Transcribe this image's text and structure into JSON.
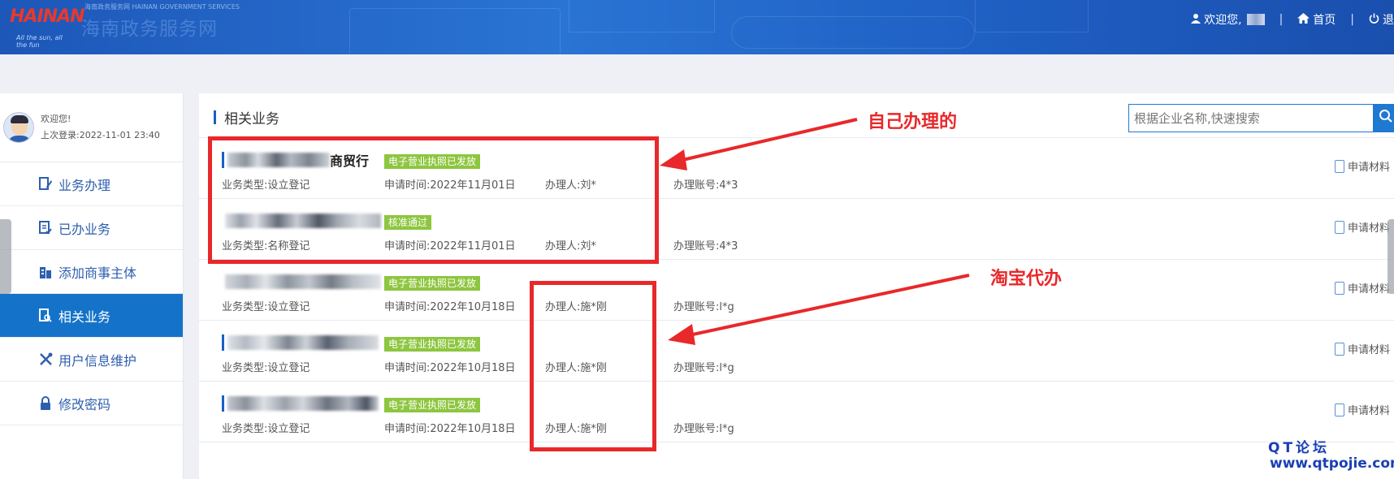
{
  "header": {
    "logo_text": "HAINAN",
    "logo_sub": "All the sun, all the fun",
    "site_small": "海南政务服务网 HAINAN GOVERNMENT SERVICES",
    "site_name": "海南政务服务网",
    "welcome": "欢迎您,",
    "home": "首页",
    "logout": "退"
  },
  "sidebar": {
    "greeting": "欢迎您!",
    "last_login": "上次登录:2022-11-01 23:40",
    "items": [
      {
        "label": "业务办理",
        "icon": "pencil-doc-icon"
      },
      {
        "label": "已办业务",
        "icon": "doc-check-icon"
      },
      {
        "label": "添加商事主体",
        "icon": "building-icon"
      },
      {
        "label": "相关业务",
        "icon": "doc-search-icon",
        "active": true
      },
      {
        "label": "用户信息维护",
        "icon": "tools-icon"
      },
      {
        "label": "修改密码",
        "icon": "lock-icon"
      }
    ]
  },
  "main": {
    "title": "相关业务",
    "search_placeholder": "根据企业名称,快速搜索",
    "doc_label": "申请材料",
    "rows": [
      {
        "name_suffix": "商贸行",
        "status": "电子营业执照已发放",
        "type": "业务类型:设立登记",
        "time": "申请时间:2022年11月01日",
        "handler": "办理人:刘*",
        "account": "办理账号:4*3"
      },
      {
        "name_suffix": "",
        "status": "核准通过",
        "type": "业务类型:名称登记",
        "time": "申请时间:2022年11月01日",
        "handler": "办理人:刘*",
        "account": "办理账号:4*3"
      },
      {
        "name_suffix": "",
        "status": "电子营业执照已发放",
        "type": "业务类型:设立登记",
        "time": "申请时间:2022年10月18日",
        "handler": "办理人:施*刚",
        "account": "办理账号:l*g"
      },
      {
        "name_suffix": "",
        "status": "电子营业执照已发放",
        "type": "业务类型:设立登记",
        "time": "申请时间:2022年10月18日",
        "handler": "办理人:施*刚",
        "account": "办理账号:l*g"
      },
      {
        "name_suffix": "",
        "status": "电子营业执照已发放",
        "type": "业务类型:设立登记",
        "time": "申请时间:2022年10月18日",
        "handler": "办理人:施*刚",
        "account": "办理账号:l*g"
      }
    ]
  },
  "annotations": {
    "self": "自己办理的",
    "taobao": "淘宝代办",
    "color": "#e8282a"
  },
  "watermark": {
    "line1": "QT论坛",
    "line2": "www.qtpojie.com"
  }
}
